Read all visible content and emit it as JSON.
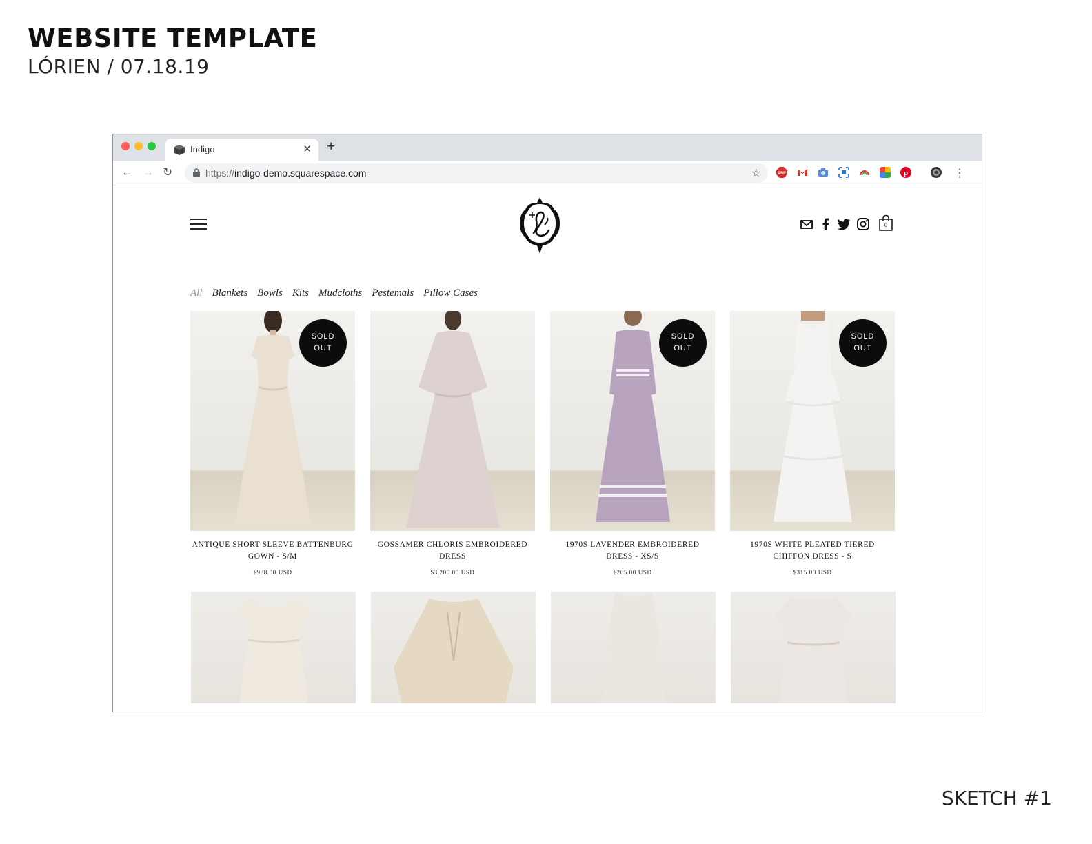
{
  "document": {
    "title": "WEBSITE TEMPLATE",
    "subtitle": "LÓRIEN / 07.18.19",
    "footer": "SKETCH #1"
  },
  "browser": {
    "tab_label": "Indigo",
    "url_scheme": "https://",
    "url_host": "indigo-demo.squarespace.com",
    "extensions": [
      "adblock-icon",
      "gmail-icon",
      "camera-icon",
      "screenshot-icon",
      "rainbow-icon",
      "color-grid-icon",
      "pinterest-icon",
      "profile-avatar"
    ]
  },
  "site": {
    "categories": [
      {
        "label": "All",
        "active": true
      },
      {
        "label": "Blankets",
        "active": false
      },
      {
        "label": "Bowls",
        "active": false
      },
      {
        "label": "Kits",
        "active": false
      },
      {
        "label": "Mudcloths",
        "active": false
      },
      {
        "label": "Pestemals",
        "active": false
      },
      {
        "label": "Pillow Cases",
        "active": false
      }
    ],
    "badge_line1": "SOLD",
    "badge_line2": "OUT",
    "cart_count": "0",
    "products": [
      {
        "name": "ANTIQUE SHORT SLEEVE BATTENBURG GOWN - S/M",
        "price": "$988.00 USD",
        "sold_out": true,
        "dress_color": "#e9e0d2"
      },
      {
        "name": "GOSSAMER CHLORIS EMBROIDERED DRESS",
        "price": "$3,200.00 USD",
        "sold_out": false,
        "dress_color": "#ddd2cf"
      },
      {
        "name": "1970S LAVENDER EMBROIDERED DRESS - XS/S",
        "price": "$265.00 USD",
        "sold_out": true,
        "dress_color": "#b7a3bd"
      },
      {
        "name": "1970S WHITE PLEATED TIERED CHIFFON DRESS - S",
        "price": "$315.00 USD",
        "sold_out": true,
        "dress_color": "#f4f3f2"
      }
    ]
  }
}
